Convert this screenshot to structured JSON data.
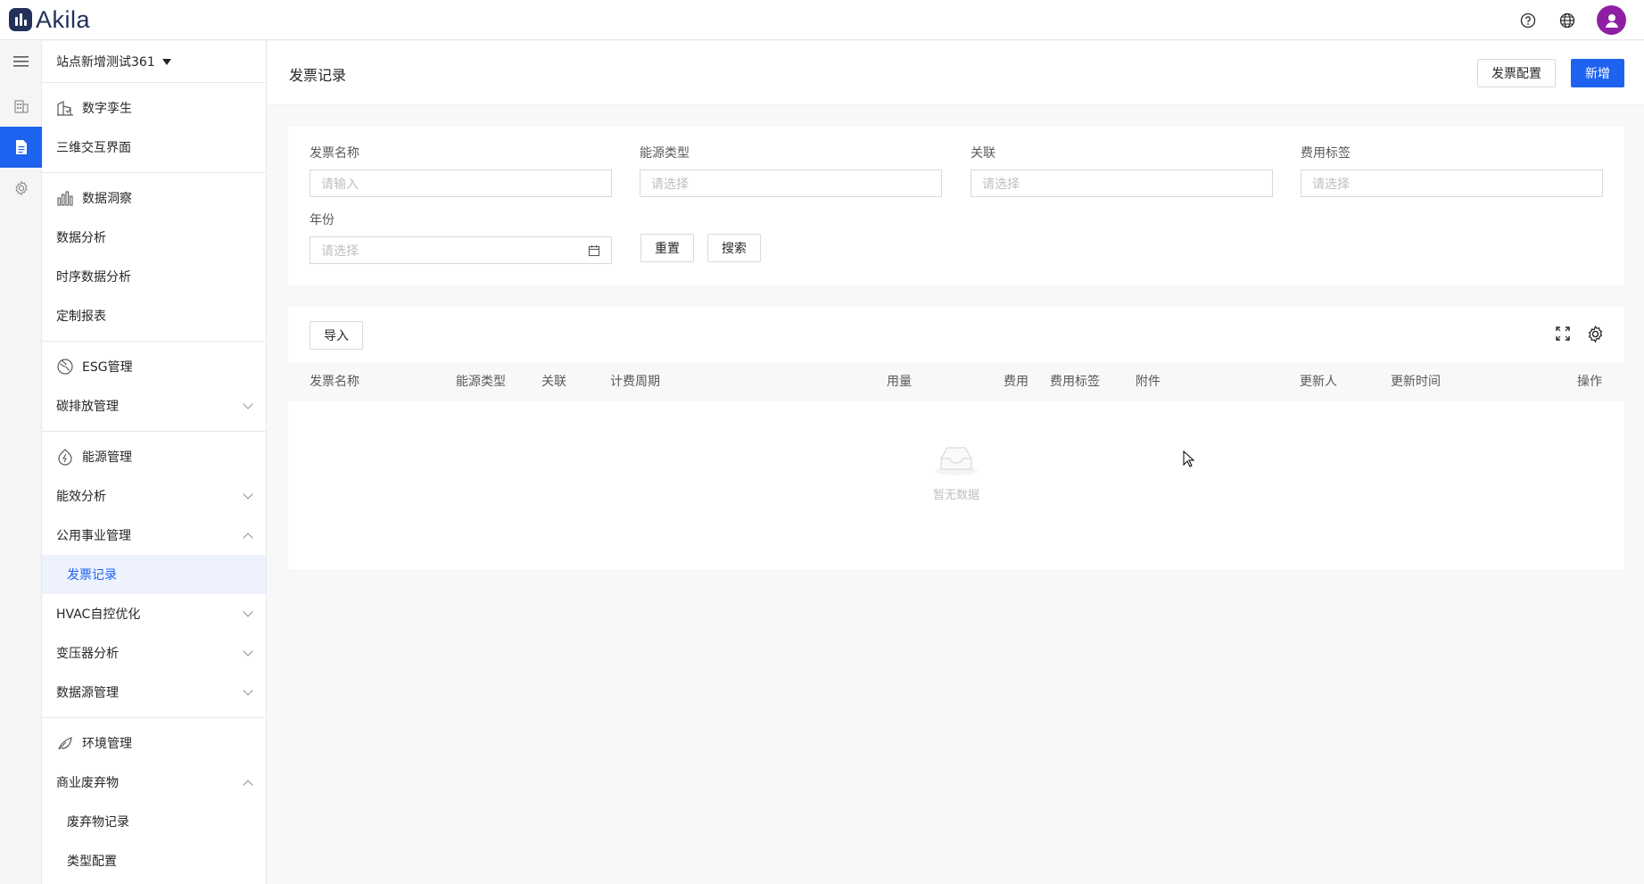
{
  "app": {
    "logo_text": "Akila"
  },
  "topbar": {
    "icons": [
      "help-icon",
      "globe-icon",
      "user-avatar-icon"
    ],
    "avatar_color": "#8e1fa3"
  },
  "rail": {
    "items": [
      "menu-icon",
      "building-icon",
      "document-icon",
      "gear-icon"
    ],
    "active_index": 2,
    "accent": "#1e62f0"
  },
  "sidebar": {
    "site": "站点新增测试361",
    "groups": [
      {
        "icon": "digital-twin-icon",
        "title": "数字孪生",
        "items": [
          {
            "label": "三维交互界面"
          }
        ]
      },
      {
        "icon": "bar-chart-icon",
        "title": "数据洞察",
        "items": [
          {
            "label": "数据分析"
          },
          {
            "label": "时序数据分析"
          },
          {
            "label": "定制报表"
          }
        ]
      },
      {
        "icon": "esg-icon",
        "title": "ESG管理",
        "items": [
          {
            "label": "碳排放管理",
            "chevron": "down"
          }
        ]
      },
      {
        "icon": "energy-icon",
        "title": "能源管理",
        "items": [
          {
            "label": "能效分析",
            "chevron": "down"
          },
          {
            "label": "公用事业管理",
            "chevron": "up"
          },
          {
            "label": "发票记录",
            "sub": true,
            "active": true
          },
          {
            "label": "HVAC自控优化",
            "chevron": "down"
          },
          {
            "label": "变压器分析",
            "chevron": "down"
          },
          {
            "label": "数据源管理",
            "chevron": "down"
          }
        ]
      },
      {
        "icon": "leaf-icon",
        "title": "环境管理",
        "items": [
          {
            "label": "商业废弃物",
            "chevron": "up"
          },
          {
            "label": "废弃物记录",
            "sub": true
          },
          {
            "label": "类型配置",
            "sub": true
          }
        ]
      }
    ]
  },
  "page": {
    "title": "发票记录",
    "config_button": "发票配置",
    "add_button": "新增"
  },
  "filters": {
    "invoice_name": {
      "label": "发票名称",
      "placeholder": "请输入"
    },
    "energy_type": {
      "label": "能源类型",
      "placeholder": "请选择"
    },
    "relation": {
      "label": "关联",
      "placeholder": "请选择"
    },
    "fee_tag": {
      "label": "费用标签",
      "placeholder": "请选择"
    },
    "year": {
      "label": "年份",
      "placeholder": "请选择"
    },
    "reset_button": "重置",
    "search_button": "搜索"
  },
  "table": {
    "import_button": "导入",
    "columns": [
      "发票名称",
      "能源类型",
      "关联",
      "计费周期",
      "用量",
      "费用",
      "费用标签",
      "附件",
      "更新人",
      "更新时间",
      "操作"
    ],
    "rows": [],
    "empty_text": "暂无数据"
  }
}
